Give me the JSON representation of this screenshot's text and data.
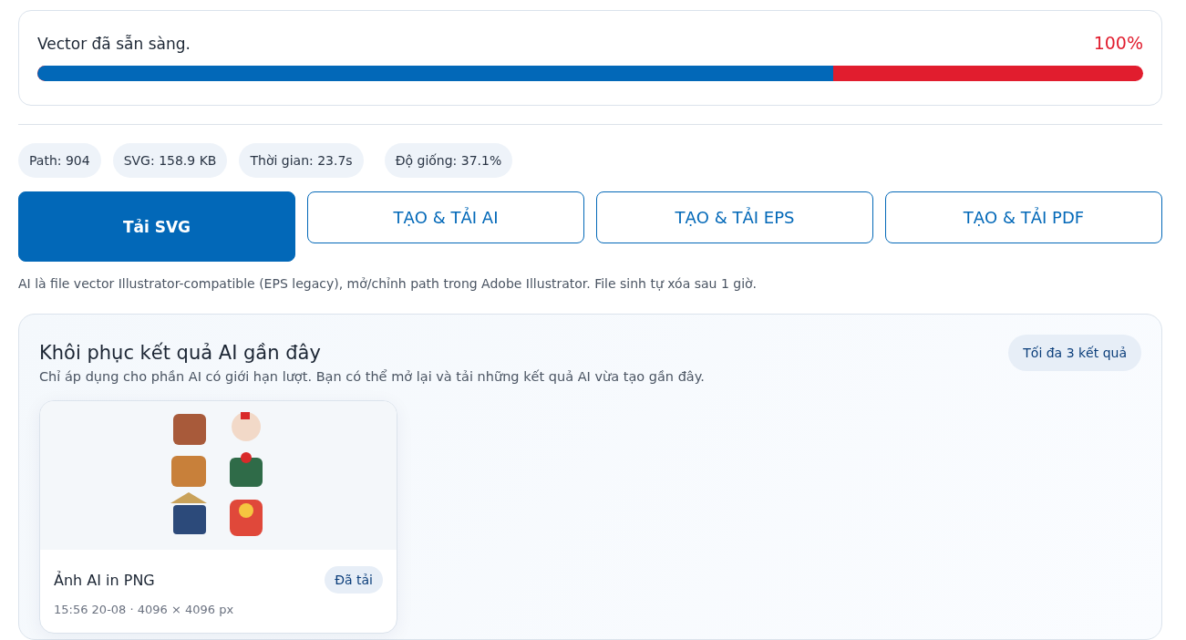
{
  "progress": {
    "label": "Vector đã sẵn sàng.",
    "reading": "100%",
    "level": 0.72
  },
  "stats": [
    "Path: 904",
    "SVG: 158.9 KB",
    "Thời gian: 23.7s",
    "Độ giống: 37.1%"
  ],
  "buttons": [
    {
      "label": "Tải SVG",
      "kind": "primary"
    },
    {
      "label": "TẠO & TẢI AI",
      "kind": "outline"
    },
    {
      "label": "TẠO & TẢI EPS",
      "kind": "outline"
    },
    {
      "label": "TẠO & TẢI PDF",
      "kind": "outline"
    }
  ],
  "note": "AI là file vector Illustrator-compatible (EPS legacy), mở/chỉnh path trong Adobe Illustrator. File sinh tự xóa sau 1 giờ.",
  "recent": {
    "title": "Khôi phục kết quả AI gần đây",
    "limit_badge": "Tối đa 3 kết quả",
    "description": "Chỉ áp dụng cho phần AI có giới hạn lượt. Bạn có thể mở lại và tải những kết quả AI vừa tạo gần đây.",
    "items": [
      {
        "kind": "picture",
        "title": "Ảnh AI in PNG",
        "status": "Đã tải",
        "meta": "15:56 20-08 · 4096 × 4096 px"
      }
    ]
  }
}
